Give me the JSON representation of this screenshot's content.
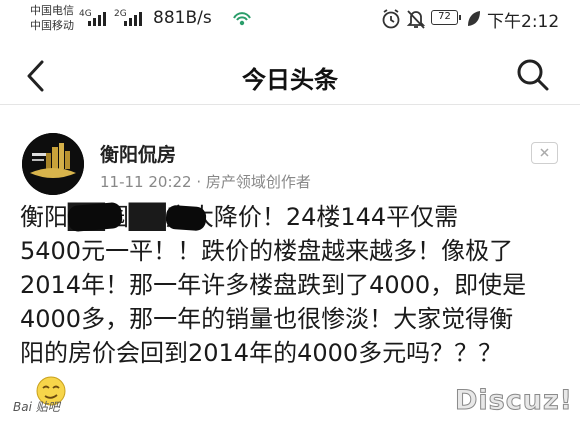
{
  "status_bar": {
    "carrier_1": "中国电信",
    "carrier_2": "中国移动",
    "net_1": "4G",
    "net_2": "2G",
    "speed": "881B/s",
    "hotspot_icon": "hotspot-icon",
    "alarm_icon": "alarm-icon",
    "mute_icon": "mute-icon",
    "battery": "72",
    "leaf_icon": "leaf-icon",
    "time": "下午2:12"
  },
  "nav": {
    "title": "今日头条",
    "back_icon": "back-arrow-icon",
    "search_icon": "search-icon"
  },
  "post": {
    "author": "衡阳侃房",
    "meta": "11-11 20:22 · 房产领域创作者",
    "close_icon": "close-icon",
    "body_lines": [
      "衡阳██园██府大降价！24楼144平仅需",
      "5400元一平！！跌价的楼盘越来越多！像极了",
      "2014年！那一年许多楼盘跌到了4000，即使是",
      "4000多，那一年的销量也很惨淡！大家觉得衡",
      "阳的房价会回到2014年的4000多元吗？？？"
    ]
  },
  "watermarks": {
    "baidu": "Bai 贴吧",
    "discuz": "Discuz!"
  },
  "colors": {
    "text": "#1a1a1a",
    "meta": "#888888",
    "divider": "#e5e5e5"
  }
}
